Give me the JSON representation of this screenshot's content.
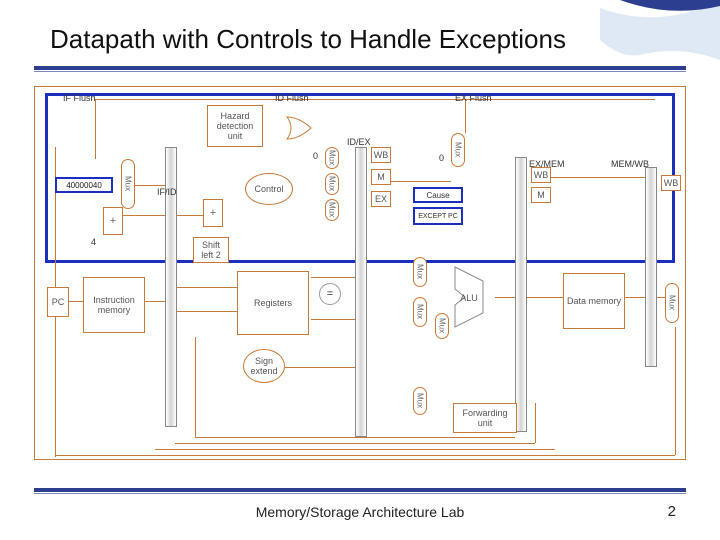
{
  "title": "Datapath with Controls to Handle Exceptions",
  "footer": "Memory/Storage Architecture Lab",
  "page": "2",
  "pipeline_labels": {
    "if_flush": "IF Flush",
    "id_flush": "ID Flush",
    "ex_flush": "EX Flush",
    "if_id": "IF/ID",
    "id_ex": "ID/EX",
    "ex_mem": "EX/MEM",
    "mem_wb": "MEM/WB"
  },
  "stage_labels": {
    "wb1": "WB",
    "m1": "M",
    "ex1": "EX",
    "wb2": "WB",
    "m2": "M",
    "wb3": "WB"
  },
  "blocks": {
    "const_addr": "40000040",
    "hazard": "Hazard detection unit",
    "control": "Control",
    "cause": "Cause",
    "except_pc": "EXCEPT PC",
    "pc": "PC",
    "instr_mem": "Instruction memory",
    "registers": "Registers",
    "sign_ext": "Sign extend",
    "shift_left": "Shift left 2",
    "alu": "ALU",
    "data_mem": "Data memory",
    "fwd": "Forwarding unit",
    "mux": "Mux",
    "eq": "="
  },
  "zero_labels": {
    "z1": "0",
    "z2": "0"
  }
}
